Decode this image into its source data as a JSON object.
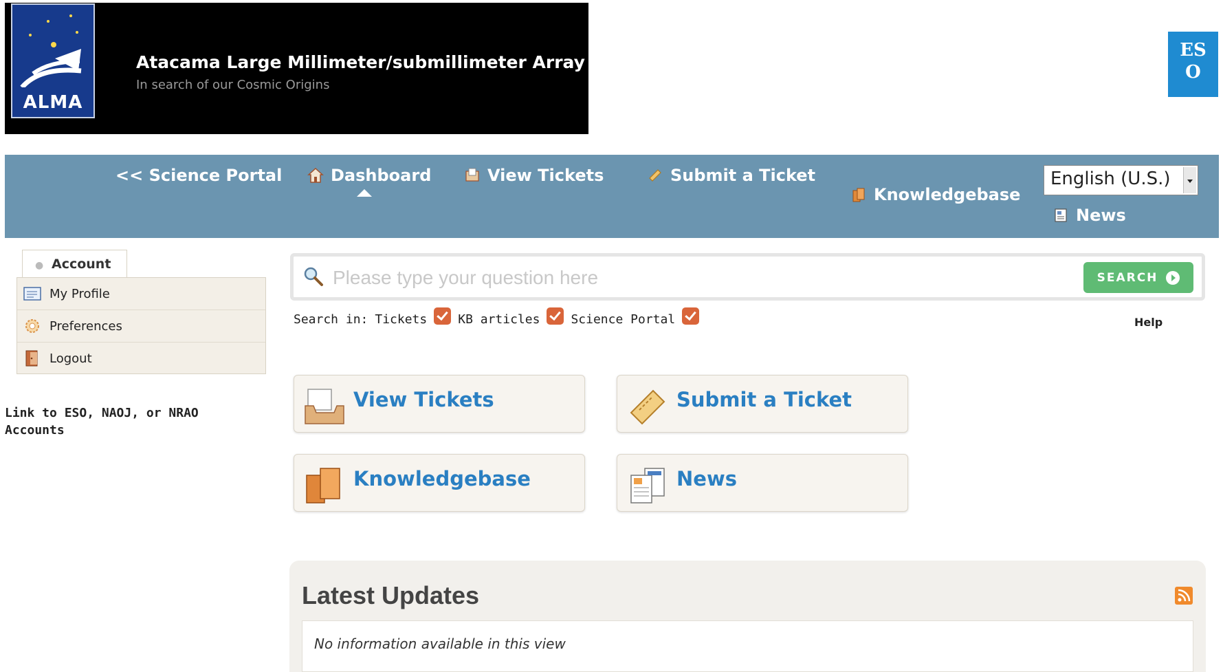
{
  "banner": {
    "logo_text": "ALMA",
    "title": "Atacama Large Millimeter/submillimeter Array",
    "subtitle": "In search of our Cosmic Origins",
    "partner_logo_text": "ES O"
  },
  "nav": {
    "science_portal": "<< Science Portal",
    "dashboard": "Dashboard",
    "view_tickets": "View Tickets",
    "submit_ticket": "Submit a Ticket",
    "knowledgebase": "Knowledgebase",
    "news": "News",
    "language": "English (U.S.)",
    "active": "Dashboard"
  },
  "sidebar": {
    "tab_label": "Account",
    "items": [
      {
        "label": "My Profile",
        "icon": "profile-card-icon"
      },
      {
        "label": "Preferences",
        "icon": "gear-icon"
      },
      {
        "label": "Logout",
        "icon": "door-icon"
      }
    ],
    "link_accounts": "Link to ESO, NAOJ, or NRAO Accounts"
  },
  "search": {
    "placeholder": "Please type your question here",
    "button_label": "SEARCH",
    "search_in_label": "Search in:",
    "options": [
      {
        "label": "Tickets",
        "checked": true
      },
      {
        "label": "KB articles",
        "checked": true
      },
      {
        "label": "Science Portal",
        "checked": true
      }
    ],
    "help_label": "Help"
  },
  "tiles": [
    {
      "label": "View Tickets",
      "icon": "inbox-icon"
    },
    {
      "label": "Submit a Ticket",
      "icon": "ticket-icon"
    },
    {
      "label": "Knowledgebase",
      "icon": "books-icon"
    },
    {
      "label": "News",
      "icon": "newspaper-icon"
    }
  ],
  "updates": {
    "title": "Latest Updates",
    "empty_message": "No information available in this view"
  },
  "colors": {
    "nav_bg": "#6b95b0",
    "tile_text": "#2a7fc2",
    "search_button": "#5fbb74",
    "checkbox": "#d9653a"
  }
}
